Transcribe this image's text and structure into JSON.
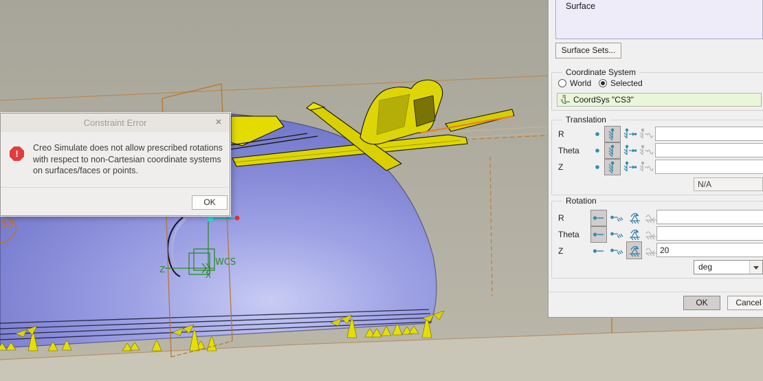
{
  "dialog": {
    "title": "Constraint Error",
    "close_glyph": "✕",
    "error_glyph": "!",
    "message": "Creo Simulate does not allow prescribed rotations with respect to non-Cartesian coordinate systems on surfaces/faces or points.",
    "ok_label": "OK"
  },
  "panel": {
    "surface_list": {
      "item": "Surface"
    },
    "surface_sets_label": "Surface Sets...",
    "coordinate_system": {
      "label": "Coordinate System",
      "world_label": "World",
      "selected_label": "Selected",
      "selected_option": "Selected",
      "coordsys_value": "CoordSys \"CS3\""
    },
    "translation": {
      "label": "Translation",
      "rows": [
        "R",
        "Theta",
        "Z"
      ],
      "na_value": "N/A"
    },
    "rotation": {
      "label": "Rotation",
      "rows": [
        "R",
        "Theta",
        "Z"
      ],
      "z_value": "20",
      "unit_value": "deg"
    },
    "ok_label": "OK",
    "cancel_label": "Cancel"
  },
  "viewport": {
    "wcs_label": "WCS",
    "axis_x": "X",
    "axis_z": "Z",
    "csys_fragment": "S3"
  },
  "colors": {
    "dome_purple": "#8286d6",
    "clip_yellow": "#ddd506",
    "datum_orange": "#b5782e",
    "wcs_green": "#2a8a2a",
    "error_red": "#e23c3c",
    "coordsys_field_green": "#e9f6d9"
  }
}
